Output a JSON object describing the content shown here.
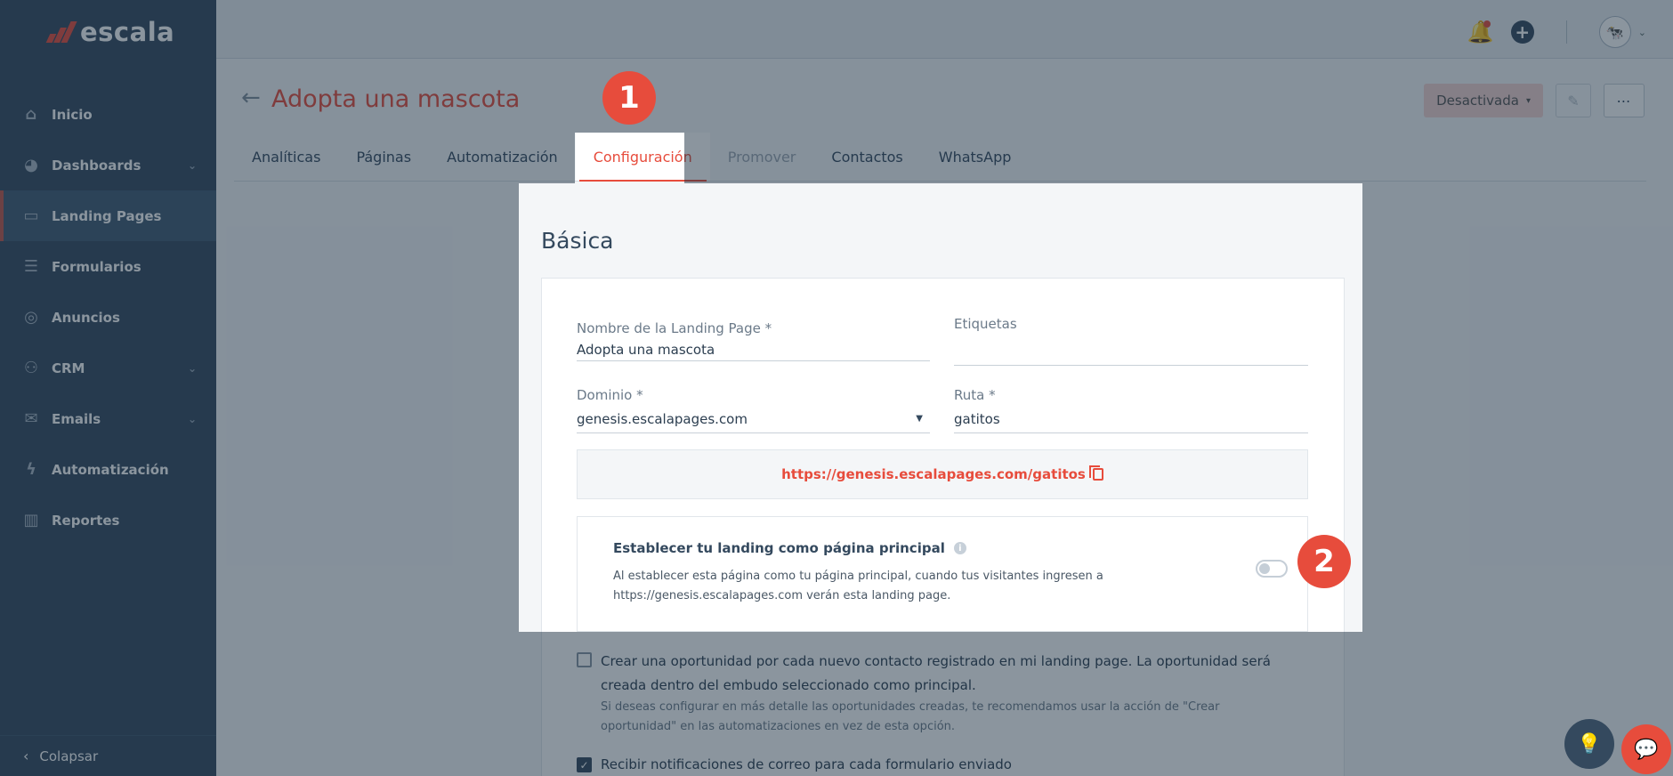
{
  "brand": {
    "name": "escala"
  },
  "sidebar": {
    "items": [
      {
        "label": "Inicio",
        "icon": "home-icon",
        "has_chevron": false
      },
      {
        "label": "Dashboards",
        "icon": "pie-chart-icon",
        "has_chevron": true
      },
      {
        "label": "Landing Pages",
        "icon": "browser-window-icon",
        "has_chevron": false,
        "active": true
      },
      {
        "label": "Formularios",
        "icon": "form-icon",
        "has_chevron": false
      },
      {
        "label": "Anuncios",
        "icon": "target-icon",
        "has_chevron": false
      },
      {
        "label": "CRM",
        "icon": "people-icon",
        "has_chevron": true
      },
      {
        "label": "Emails",
        "icon": "envelope-icon",
        "has_chevron": true
      },
      {
        "label": "Automatización",
        "icon": "lightning-icon",
        "has_chevron": false
      },
      {
        "label": "Reportes",
        "icon": "bar-chart-icon",
        "has_chevron": false
      }
    ],
    "collapse_label": "Colapsar"
  },
  "header": {
    "page_title": "Adopta una mascota",
    "status_button": "Desactivada"
  },
  "tabs": [
    {
      "label": "Analíticas",
      "state": "normal"
    },
    {
      "label": "Páginas",
      "state": "normal"
    },
    {
      "label": "Automatización",
      "state": "normal"
    },
    {
      "label": "Configuración",
      "state": "active"
    },
    {
      "label": "Promover",
      "state": "disabled"
    },
    {
      "label": "Contactos",
      "state": "normal"
    },
    {
      "label": "WhatsApp",
      "state": "normal"
    }
  ],
  "settings": {
    "section_title": "Básica",
    "name_label": "Nombre de la Landing Page *",
    "name_value": "Adopta una mascota",
    "tags_label": "Etiquetas",
    "tags_value": "",
    "domain_label": "Dominio *",
    "domain_value": "genesis.escalapages.com",
    "route_label": "Ruta *",
    "route_value": "gatitos",
    "full_url": "https://genesis.escalapages.com/gatitos",
    "main_page_title": "Establecer tu landing como página principal",
    "main_page_desc": "Al establecer esta página como tu página principal, cuando tus visitantes ingresen a https://genesis.escalapages.com verán esta landing page.",
    "main_page_enabled": false,
    "opportunity_checkbox": {
      "checked": false,
      "text": "Crear una oportunidad por cada nuevo contacto registrado en mi landing page. La oportunidad será creada dentro del embudo seleccionado como principal.",
      "hint": "Si deseas configurar en más detalle las oportunidades creadas, te recomendamos usar la acción de \"Crear oportunidad\" en las automatizaciones en vez de esta opción."
    },
    "notify_checkbox": {
      "checked": true,
      "text": "Recibir notificaciones de correo para cada formulario enviado"
    }
  },
  "step_badges": [
    "1",
    "2"
  ],
  "colors": {
    "accent": "#e74c3c",
    "sidebar": "#34495e"
  }
}
